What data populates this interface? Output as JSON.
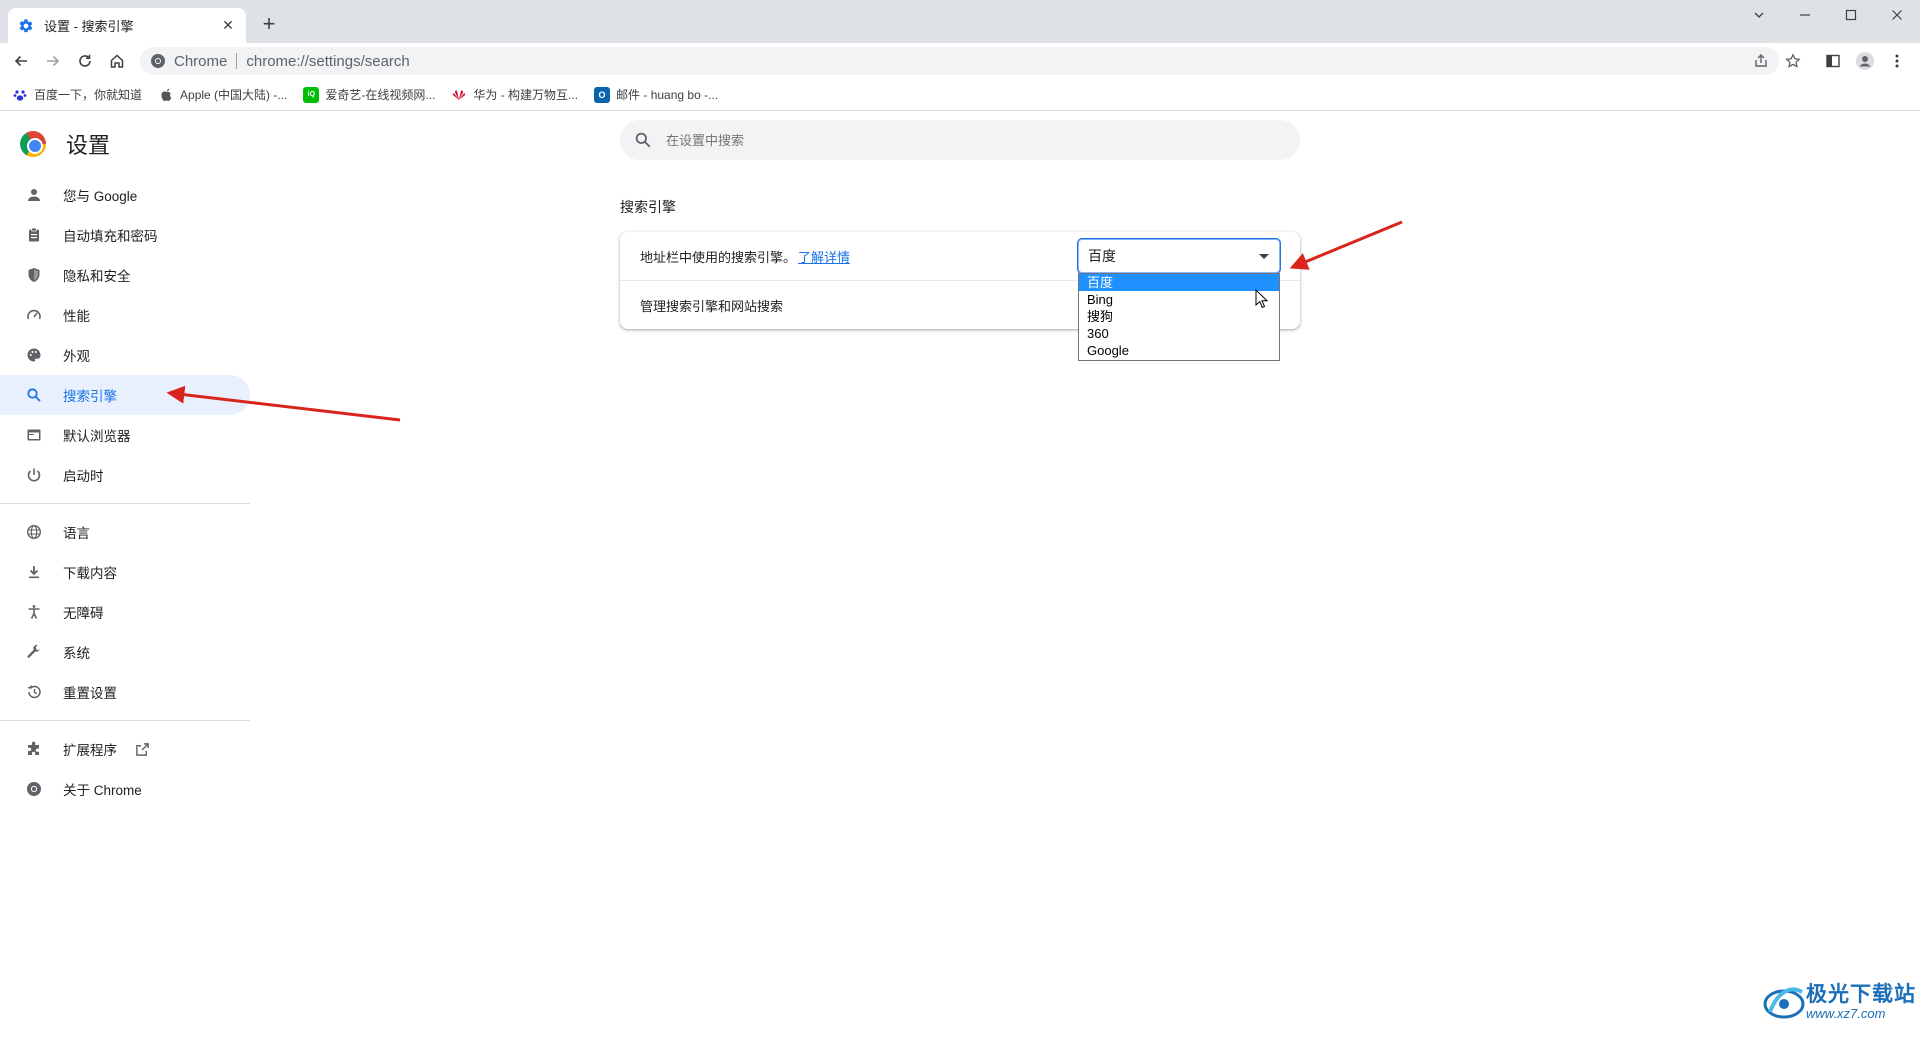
{
  "tab": {
    "title": "设置 - 搜索引擎",
    "close": "✕",
    "favicon": "gear-icon"
  },
  "newtab": "+",
  "window_controls": {
    "dropdown": "chevron-down",
    "minimize": "—",
    "maximize": "☐",
    "close": "✕"
  },
  "omnibox": {
    "scheme": "Chrome",
    "url": "chrome://settings/search"
  },
  "bookmarks": [
    {
      "label": "百度一下，你就知道",
      "icon": "baidu-paw-icon",
      "color": "#2932e1"
    },
    {
      "label": "Apple (中国大陆) -...",
      "icon": "apple-icon",
      "color": "#555555"
    },
    {
      "label": "爱奇艺-在线视频网...",
      "icon": "iqiyi-icon",
      "color": "#00be06"
    },
    {
      "label": "华为 - 构建万物互...",
      "icon": "huawei-icon",
      "color": "#cf0a2c"
    },
    {
      "label": "邮件 - huang bo -...",
      "icon": "outlook-icon",
      "color": "#0a64ad"
    }
  ],
  "settings": {
    "brand_name": "设置",
    "search_placeholder": "在设置中搜索",
    "nav_primary": [
      {
        "label": "您与 Google",
        "icon": "person-icon"
      },
      {
        "label": "自动填充和密码",
        "icon": "clipboard-icon"
      },
      {
        "label": "隐私和安全",
        "icon": "shield-icon"
      },
      {
        "label": "性能",
        "icon": "speedometer-icon"
      },
      {
        "label": "外观",
        "icon": "palette-icon"
      },
      {
        "label": "搜索引擎",
        "icon": "search-icon"
      },
      {
        "label": "默认浏览器",
        "icon": "browser-icon"
      },
      {
        "label": "启动时",
        "icon": "power-icon"
      }
    ],
    "nav_secondary": [
      {
        "label": "语言",
        "icon": "globe-icon"
      },
      {
        "label": "下载内容",
        "icon": "download-icon"
      },
      {
        "label": "无障碍",
        "icon": "accessibility-icon"
      },
      {
        "label": "系统",
        "icon": "wrench-icon"
      },
      {
        "label": "重置设置",
        "icon": "restore-icon"
      }
    ],
    "nav_tertiary": [
      {
        "label": "扩展程序",
        "icon": "puzzle-icon"
      },
      {
        "label": "关于 Chrome",
        "icon": "chrome-icon"
      }
    ],
    "active_item": "搜索引擎",
    "section_title": "搜索引擎",
    "row1_text": "地址栏中使用的搜索引擎。",
    "row1_link": "了解详情",
    "row2_text": "管理搜索引擎和网站搜索",
    "select_value": "百度",
    "options": [
      "百度",
      "Bing",
      "搜狗",
      "360",
      "Google"
    ],
    "selected_option": "百度"
  },
  "watermark": {
    "title": "极光下载站",
    "url": "www.xz7.com"
  },
  "colors": {
    "accent": "#1a73e8",
    "active_bg": "#e8f0fe",
    "annotation_arrow": "#d9251d"
  }
}
